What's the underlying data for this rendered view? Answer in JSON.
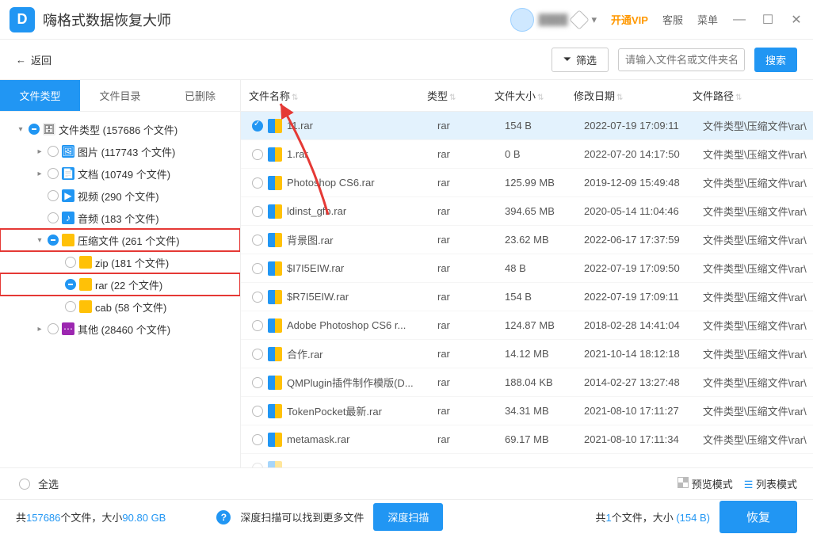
{
  "titlebar": {
    "app": "嗨格式数据恢复大师",
    "vip": "开通VIP",
    "support": "客服",
    "menu": "菜单"
  },
  "toolbar": {
    "back": "返回",
    "filter": "筛选",
    "search_placeholder": "请输入文件名或文件夹名",
    "search": "搜索"
  },
  "tabs": {
    "t1": "文件类型",
    "t2": "文件目录",
    "t3": "已删除"
  },
  "tree": {
    "root": "文件类型 (157686 个文件)",
    "img": "图片 (117743 个文件)",
    "doc": "文档 (10749 个文件)",
    "vid": "视频 (290 个文件)",
    "aud": "音频 (183 个文件)",
    "arc": "压缩文件 (261 个文件)",
    "zip": "zip (181 个文件)",
    "rar": "rar (22 个文件)",
    "cab": "cab (58 个文件)",
    "other": "其他 (28460 个文件)"
  },
  "columns": {
    "name": "文件名称",
    "type": "类型",
    "size": "文件大小",
    "date": "修改日期",
    "path": "文件路径"
  },
  "rows": [
    {
      "n": "11.rar",
      "t": "rar",
      "s": "154 B",
      "d": "2022-07-19 17:09:11",
      "p": "文件类型\\压缩文件\\rar\\",
      "sel": true
    },
    {
      "n": "1.rar",
      "t": "rar",
      "s": "0 B",
      "d": "2022-07-20 14:17:50",
      "p": "文件类型\\压缩文件\\rar\\"
    },
    {
      "n": "Photoshop CS6.rar",
      "t": "rar",
      "s": "125.99 MB",
      "d": "2019-12-09 15:49:48",
      "p": "文件类型\\压缩文件\\rar\\"
    },
    {
      "n": "ldinst_gfb.rar",
      "t": "rar",
      "s": "394.65 MB",
      "d": "2020-05-14 11:04:46",
      "p": "文件类型\\压缩文件\\rar\\"
    },
    {
      "n": "背景图.rar",
      "t": "rar",
      "s": "23.62 MB",
      "d": "2022-06-17 17:37:59",
      "p": "文件类型\\压缩文件\\rar\\"
    },
    {
      "n": "$I7I5EIW.rar",
      "t": "rar",
      "s": "48 B",
      "d": "2022-07-19 17:09:50",
      "p": "文件类型\\压缩文件\\rar\\"
    },
    {
      "n": "$R7I5EIW.rar",
      "t": "rar",
      "s": "154 B",
      "d": "2022-07-19 17:09:11",
      "p": "文件类型\\压缩文件\\rar\\"
    },
    {
      "n": "Adobe Photoshop CS6  r...",
      "t": "rar",
      "s": "124.87 MB",
      "d": "2018-02-28 14:41:04",
      "p": "文件类型\\压缩文件\\rar\\"
    },
    {
      "n": "合作.rar",
      "t": "rar",
      "s": "14.12 MB",
      "d": "2021-10-14 18:12:18",
      "p": "文件类型\\压缩文件\\rar\\"
    },
    {
      "n": "QMPlugin插件制作模版(D...",
      "t": "rar",
      "s": "188.04 KB",
      "d": "2014-02-27 13:27:48",
      "p": "文件类型\\压缩文件\\rar\\"
    },
    {
      "n": "TokenPocket最新.rar",
      "t": "rar",
      "s": "34.31 MB",
      "d": "2021-08-10 17:11:27",
      "p": "文件类型\\压缩文件\\rar\\"
    },
    {
      "n": "metamask.rar",
      "t": "rar",
      "s": "69.17 MB",
      "d": "2021-08-10 17:11:34",
      "p": "文件类型\\压缩文件\\rar\\"
    }
  ],
  "footer1": {
    "all": "全选",
    "preview": "预览模式",
    "list": "列表模式"
  },
  "footer2": {
    "total_a": "共",
    "total_count": "157686",
    "total_b": "个文件，大小",
    "total_size": "90.80 GB",
    "deep_tip": "深度扫描可以找到更多文件",
    "deep_btn": "深度扫描",
    "sel_a": "共",
    "sel_count": "1",
    "sel_b": "个文件，大小",
    "sel_size": "(154 B)",
    "recover": "恢复"
  }
}
